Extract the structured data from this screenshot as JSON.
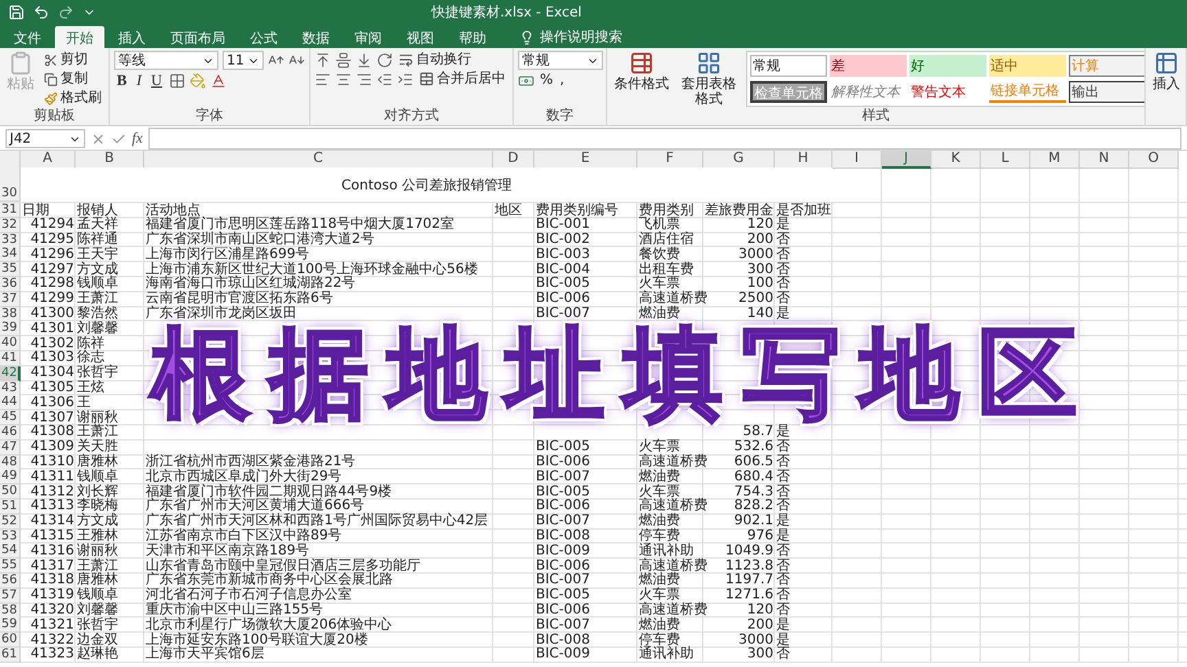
{
  "window": {
    "title": "快捷键素材.xlsx  -  Excel"
  },
  "tabs": [
    {
      "label": "文件",
      "selected": false
    },
    {
      "label": "开始",
      "selected": true
    },
    {
      "label": "插入",
      "selected": false
    },
    {
      "label": "页面布局",
      "selected": false
    },
    {
      "label": "公式",
      "selected": false
    },
    {
      "label": "数据",
      "selected": false
    },
    {
      "label": "审阅",
      "selected": false
    },
    {
      "label": "视图",
      "selected": false
    },
    {
      "label": "帮助",
      "selected": false
    }
  ],
  "tell_me": "操作说明搜索",
  "ribbon": {
    "clipboard": {
      "label": "剪贴板",
      "paste": {
        "label": "粘贴",
        "disabled": true
      },
      "cut": "剪切",
      "copy": "复制",
      "format_painter": "格式刷"
    },
    "font": {
      "label": "字体",
      "font_name": "等线",
      "font_size": "11",
      "bold": "B",
      "italic": "I",
      "underline": "U"
    },
    "alignment": {
      "label": "对齐方式",
      "wrap": "自动换行",
      "merge": "合并后居中"
    },
    "number": {
      "label": "数字",
      "format": "常规",
      "percent": "%",
      "comma": ","
    },
    "styles": {
      "label": "样式",
      "conditional": "条件格式",
      "table": "套用表格格式",
      "gallery": [
        {
          "label": "常规",
          "kind": "normal"
        },
        {
          "label": "差",
          "kind": "bad"
        },
        {
          "label": "好",
          "kind": "good"
        },
        {
          "label": "适中",
          "kind": "neutral"
        },
        {
          "label": "计算",
          "kind": "calculation"
        },
        {
          "label": "检查单元格",
          "kind": "check"
        },
        {
          "label": "解释性文本",
          "kind": "explanatory"
        },
        {
          "label": "警告文本",
          "kind": "warning"
        },
        {
          "label": "链接单元格",
          "kind": "linked"
        },
        {
          "label": "输出",
          "kind": "output"
        }
      ]
    },
    "cells": {
      "insert": "插入"
    }
  },
  "formula_bar": {
    "name_box": "J42",
    "function_label": "fx"
  },
  "columns": [
    {
      "label": "A",
      "selected": false
    },
    {
      "label": "B",
      "selected": false
    },
    {
      "label": "C",
      "selected": false
    },
    {
      "label": "D",
      "selected": false
    },
    {
      "label": "E",
      "selected": false
    },
    {
      "label": "F",
      "selected": false
    },
    {
      "label": "G",
      "selected": false
    },
    {
      "label": "H",
      "selected": false
    },
    {
      "label": "I",
      "selected": false
    },
    {
      "label": "J",
      "selected": true
    },
    {
      "label": "K",
      "selected": false
    },
    {
      "label": "L",
      "selected": false
    },
    {
      "label": "M",
      "selected": false
    },
    {
      "label": "N",
      "selected": false
    },
    {
      "label": "O",
      "selected": false
    }
  ],
  "rows": [
    {
      "number": "30",
      "kind": "title",
      "selected": false,
      "title": "Contoso 公司差旅报销管理"
    },
    {
      "number": "31",
      "kind": "header",
      "selected": false,
      "date": "日期",
      "person": "报销人",
      "address": "活动地点",
      "region": "地区",
      "code": "费用类别编号",
      "category": "费用类别",
      "amount": "差旅费用金",
      "overtime": "是否加班"
    },
    {
      "number": "32",
      "kind": "data",
      "selected": false,
      "date": "41294",
      "person": "孟天祥",
      "address": "福建省厦门市思明区莲岳路118号中烟大厦1702室",
      "code": "BIC-001",
      "category": "飞机票",
      "amount": "120",
      "overtime": "是"
    },
    {
      "number": "33",
      "kind": "data",
      "selected": false,
      "date": "41295",
      "person": "陈祥通",
      "address": "广东省深圳市南山区蛇口港湾大道2号",
      "code": "BIC-002",
      "category": "酒店住宿",
      "amount": "200",
      "overtime": "否"
    },
    {
      "number": "34",
      "kind": "data",
      "selected": false,
      "date": "41296",
      "person": "王天宇",
      "address": "上海市闵行区浦星路699号",
      "code": "BIC-003",
      "category": "餐饮费",
      "amount": "3000",
      "overtime": "否"
    },
    {
      "number": "35",
      "kind": "data",
      "selected": false,
      "date": "41297",
      "person": "方文成",
      "address": "上海市浦东新区世纪大道100号上海环球金融中心56楼",
      "code": "BIC-004",
      "category": "出租车费",
      "amount": "300",
      "overtime": "否"
    },
    {
      "number": "36",
      "kind": "data",
      "selected": false,
      "date": "41298",
      "person": "钱顺卓",
      "address": "海南省海口市琼山区红城湖路22号",
      "code": "BIC-005",
      "category": "火车票",
      "amount": "100",
      "overtime": "否"
    },
    {
      "number": "37",
      "kind": "data",
      "selected": false,
      "date": "41299",
      "person": "王萧江",
      "address": "云南省昆明市官渡区拓东路6号",
      "code": "BIC-006",
      "category": "高速道桥费",
      "amount": "2500",
      "overtime": "否"
    },
    {
      "number": "38",
      "kind": "data",
      "selected": false,
      "date": "41300",
      "person": "黎浩然",
      "address": "广东省深圳市龙岗区坂田",
      "code": "BIC-007",
      "category": "燃油费",
      "amount": "140",
      "overtime": "是"
    },
    {
      "number": "39",
      "kind": "data",
      "selected": false,
      "date": "41301",
      "person": "刘馨馨"
    },
    {
      "number": "40",
      "kind": "data",
      "selected": false,
      "date": "41302",
      "person": "陈祥"
    },
    {
      "number": "41",
      "kind": "data",
      "selected": false,
      "date": "41303",
      "person": "徐志"
    },
    {
      "number": "42",
      "kind": "data",
      "selected": true,
      "date": "41304",
      "person": "张哲宇"
    },
    {
      "number": "43",
      "kind": "data",
      "selected": false,
      "date": "41305",
      "person": "王炫"
    },
    {
      "number": "44",
      "kind": "data",
      "selected": false,
      "date": "41306",
      "person": "王"
    },
    {
      "number": "45",
      "kind": "data",
      "selected": false,
      "date": "41307",
      "person": "谢丽秋"
    },
    {
      "number": "46",
      "kind": "data",
      "selected": false,
      "date": "41308",
      "person": "王萧江",
      "amount": "58.7",
      "overtime": "是"
    },
    {
      "number": "47",
      "kind": "data",
      "selected": false,
      "date": "41309",
      "person": "关天胜",
      "code": "BIC-005",
      "category": "火车票",
      "amount": "532.6",
      "overtime": "否"
    },
    {
      "number": "48",
      "kind": "data",
      "selected": false,
      "date": "41310",
      "person": "唐雅林",
      "address": "浙江省杭州市西湖区紫金港路21号",
      "code": "BIC-006",
      "category": "高速道桥费",
      "amount": "606.5",
      "overtime": "否"
    },
    {
      "number": "49",
      "kind": "data",
      "selected": false,
      "date": "41311",
      "person": "钱顺卓",
      "address": "北京市西城区阜成门外大街29号",
      "code": "BIC-007",
      "category": "燃油费",
      "amount": "680.4",
      "overtime": "否"
    },
    {
      "number": "50",
      "kind": "data",
      "selected": false,
      "date": "41312",
      "person": "刘长辉",
      "address": "福建省厦门市软件园二期观日路44号9楼",
      "code": "BIC-005",
      "category": "火车票",
      "amount": "754.3",
      "overtime": "否"
    },
    {
      "number": "51",
      "kind": "data",
      "selected": false,
      "date": "41313",
      "person": "李晓梅",
      "address": "广东省广州市天河区黄埔大道666号",
      "code": "BIC-006",
      "category": "高速道桥费",
      "amount": "828.2",
      "overtime": "否"
    },
    {
      "number": "52",
      "kind": "data",
      "selected": false,
      "date": "41314",
      "person": "方文成",
      "address": "广东省广州市天河区林和西路1号广州国际贸易中心42层",
      "code": "BIC-007",
      "category": "燃油费",
      "amount": "902.1",
      "overtime": "是"
    },
    {
      "number": "53",
      "kind": "data",
      "selected": false,
      "date": "41315",
      "person": "王雅林",
      "address": "江苏省南京市白下区汉中路89号",
      "code": "BIC-008",
      "category": "停车费",
      "amount": "976",
      "overtime": "是"
    },
    {
      "number": "54",
      "kind": "data",
      "selected": false,
      "date": "41316",
      "person": "谢丽秋",
      "address": "天津市和平区南京路189号",
      "code": "BIC-009",
      "category": "通讯补助",
      "amount": "1049.9",
      "overtime": "否"
    },
    {
      "number": "55",
      "kind": "data",
      "selected": false,
      "date": "41317",
      "person": "王萧江",
      "address": "山东省青岛市颐中皇冠假日酒店三层多功能厅",
      "code": "BIC-006",
      "category": "高速道桥费",
      "amount": "1123.8",
      "overtime": "否"
    },
    {
      "number": "56",
      "kind": "data",
      "selected": false,
      "date": "41318",
      "person": "唐雅林",
      "address": "广东省东莞市新城市商务中心区会展北路",
      "code": "BIC-007",
      "category": "燃油费",
      "amount": "1197.7",
      "overtime": "否"
    },
    {
      "number": "57",
      "kind": "data",
      "selected": false,
      "date": "41319",
      "person": "钱顺卓",
      "address": "河北省石河子市石河子信息办公室",
      "code": "BIC-005",
      "category": "火车票",
      "amount": "1271.6",
      "overtime": "否"
    },
    {
      "number": "58",
      "kind": "data",
      "selected": false,
      "date": "41320",
      "person": "刘馨馨",
      "address": "重庆市渝中区中山三路155号",
      "code": "BIC-006",
      "category": "高速道桥费",
      "amount": "120",
      "overtime": "否"
    },
    {
      "number": "59",
      "kind": "data",
      "selected": false,
      "date": "41321",
      "person": "张哲宇",
      "address": "北京市利星行广场微软大厦206体验中心",
      "code": "BIC-007",
      "category": "燃油费",
      "amount": "200",
      "overtime": "是"
    },
    {
      "number": "60",
      "kind": "data",
      "selected": false,
      "date": "41322",
      "person": "边金双",
      "address": "上海市延安东路100号联谊大厦20楼",
      "code": "BIC-008",
      "category": "停车费",
      "amount": "3000",
      "overtime": "是"
    },
    {
      "number": "61",
      "kind": "data",
      "selected": false,
      "date": "41323",
      "person": "赵琳艳",
      "address": "上海市天平宾馆6层",
      "code": "BIC-009",
      "category": "通讯补助",
      "amount": "300",
      "overtime": "否"
    }
  ],
  "overlay_caption": "根据地址填写地区"
}
